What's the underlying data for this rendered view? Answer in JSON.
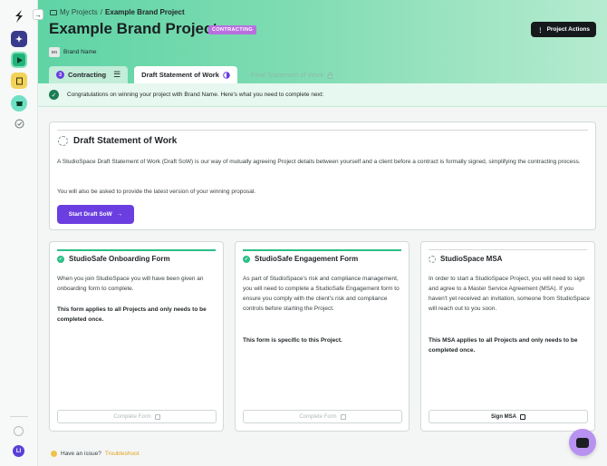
{
  "breadcrumb": {
    "parent": "My Projects",
    "separator": "/",
    "current": "Example Brand Project"
  },
  "header": {
    "title": "Example Brand Project",
    "status": "CONTRACTING",
    "actions_label": "Project Actions",
    "brand_initials": "BN",
    "brand_name": "Brand Name"
  },
  "tabs": [
    {
      "number": "3",
      "label": "Contracting"
    },
    {
      "label": "Draft Statement of Work"
    },
    {
      "label": "Final Statement of Work"
    }
  ],
  "banner": {
    "text": "Congratulations on winning your project with Brand Name. Here's what you need to complete next:"
  },
  "sow": {
    "title": "Draft Statement of Work",
    "description": "A StudioSpace Draft Statement of Work (Draft SoW) is our way of mutually agreeing Project details between yourself and a client before a contract is formally signed, simplifying the contracting process.",
    "note": "You will also be asked to provide the latest version of your winning proposal.",
    "button": "Start Draft SoW"
  },
  "tasks": [
    {
      "title": "StudioSafe Onboarding Form",
      "description": "When you join StudioSpace you will have been given an onboarding form to complete.",
      "note": "This form applies to all Projects and only needs to be completed once.",
      "button": "Complete Form"
    },
    {
      "title": "StudioSafe Engagement Form",
      "description": "As part of StudioSpace's risk and compliance management, you will need to complete a StudioSafe Engagement form to ensure you comply with the client's risk and compliance controls before starting the Project.",
      "note": "This form is specific to this Project.",
      "button": "Complete Form"
    },
    {
      "title": "StudioSpace MSA",
      "description": "In order to start a StudioSpace Project, you will need to sign and agree to a Master Service Agreement (MSA). If you haven't yet received an invitation, someone from StudioSpace will reach out to you soon.",
      "note": "This MSA applies to all Projects and only needs to be completed once.",
      "button": "Sign MSA"
    }
  ],
  "footer": {
    "question": "Have an issue?",
    "link": "Troubleshoot"
  },
  "user": {
    "initials": "LI"
  },
  "colors": {
    "accent": "#6a3ee0",
    "success": "#2bbf87",
    "header_green": "#5fd4a5",
    "badge": "#b96fe0"
  }
}
